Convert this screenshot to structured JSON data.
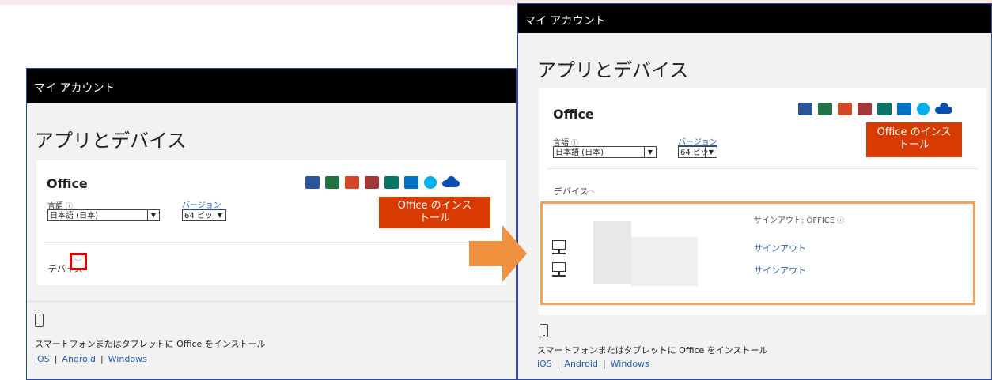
{
  "left_screen": {
    "header_title": "マイ アカウント",
    "page_title": "アプリとデバイス",
    "card": {
      "office_title": "Office",
      "language_label": "言語",
      "language_info_icon": "ⓘ",
      "language_value": "日本語 (日本)",
      "version_label": "バージョン",
      "version_value": "64 ビッ",
      "install_label_line1": "Office のインス",
      "install_label_line2": "トール",
      "devices_label": "デバイス",
      "chevron_glyph": "﹀"
    },
    "mobile": {
      "text": "スマートフォンまたはタブレットに Office をインストール",
      "links": [
        "iOS",
        "Android",
        "Windows"
      ],
      "separator": "|"
    }
  },
  "right_screen": {
    "header_title": "マイ アカウント",
    "page_title": "アプリとデバイス",
    "card": {
      "office_title": "Office",
      "language_label": "言語",
      "language_info_icon": "ⓘ",
      "language_value": "日本語 (日本)",
      "version_label": "バージョン",
      "version_value": "64 ビッ",
      "install_label_line1": "Office のインス",
      "install_label_line2": "トール",
      "devices_label": "デバイス",
      "chevron_glyph": "︿",
      "signout_status": "サインアウト: OFFICE",
      "signout_link_1": "サインアウト",
      "signout_link_2": "サインアウト"
    },
    "mobile": {
      "text": "スマートフォンまたはタブレットに Office をインストール",
      "links": [
        "iOS",
        "Android",
        "Windows"
      ],
      "separator": "|"
    }
  },
  "select_arrow_glyph": "▼",
  "app_icons": [
    {
      "name": "word-icon",
      "color": "#2b579a"
    },
    {
      "name": "excel-icon",
      "color": "#217346"
    },
    {
      "name": "powerpoint-icon",
      "color": "#d24726"
    },
    {
      "name": "access-icon",
      "color": "#a4373a"
    },
    {
      "name": "publisher-icon",
      "color": "#077568"
    },
    {
      "name": "outlook-icon",
      "color": "#0072c6"
    },
    {
      "name": "skype-icon",
      "color": "#00aff0"
    },
    {
      "name": "onedrive-icon",
      "color": "#0a4eb0"
    }
  ],
  "colors": {
    "header_bg": "#000000",
    "install_button": "#d83b01",
    "link": "#1f5db3",
    "highlight_red": "#e00000",
    "highlight_orange": "#f2a05a",
    "arrow": "#f0913f"
  }
}
